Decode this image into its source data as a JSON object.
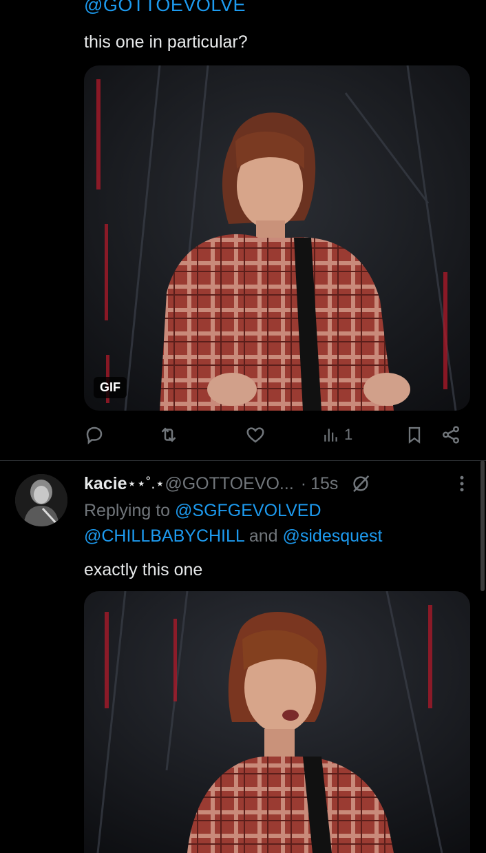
{
  "tweet1": {
    "clipped_handle": "@GOTTOEVOLVE",
    "text": "this one in particular?",
    "media_badge": "GIF",
    "actions": {
      "reply_icon": "reply-icon",
      "retweet_icon": "retweet-icon",
      "like_icon": "heart-icon",
      "views_icon": "analytics-icon",
      "views_count": "1",
      "bookmark_icon": "bookmark-icon",
      "share_icon": "share-icon"
    }
  },
  "tweet2": {
    "display_name": "kacie",
    "name_decoration": " ⋆⋆˚.⋆ ",
    "handle": "@GOTTOEVO...",
    "separator": "·",
    "time": "15s",
    "replying_prefix": "Replying to",
    "reply_to_1": "@SGFGEVOLVED",
    "reply_to_2": "@CHILLBABYCHILL",
    "reply_and": "and",
    "reply_to_3": "@sidesquest",
    "text": "exactly this one"
  },
  "colors": {
    "background": "#000000",
    "text": "#e7e9ea",
    "secondary": "#71767b",
    "link": "#1d9bf0",
    "divider": "#2f3336"
  }
}
